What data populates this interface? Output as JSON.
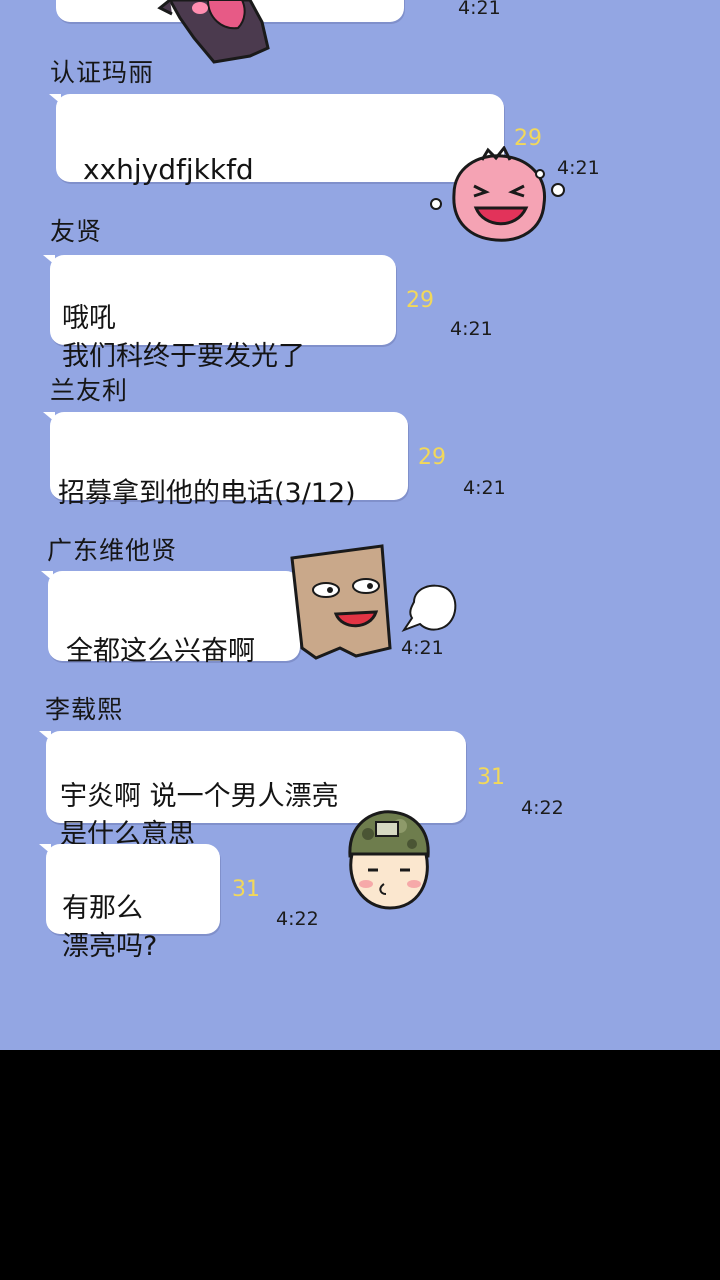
{
  "messages": [
    {
      "sender": "",
      "text": "",
      "count": "",
      "time": "4:21"
    },
    {
      "sender": "认证玛丽",
      "text": "xxhjydfjkkfd",
      "count": "29",
      "time": "4:21"
    },
    {
      "sender": "友贤",
      "text": "哦吼\n我们科终于要发光了",
      "count": "29",
      "time": "4:21"
    },
    {
      "sender": "兰友利",
      "text": "招募拿到他的电话(3/12)",
      "count": "29",
      "time": "4:21"
    },
    {
      "sender": "广东维他贤",
      "text": "全都这么兴奋啊",
      "count": "",
      "time": "4:21"
    },
    {
      "sender": "李载熙",
      "text": "宇炎啊 说一个男人漂亮\n是什么意思",
      "count": "31",
      "time": "4:22"
    },
    {
      "sender": "",
      "text": "有那么\n漂亮吗?",
      "count": "31",
      "time": "4:22"
    }
  ],
  "colors": {
    "background": "#93a6e3",
    "bubble": "#ffffff",
    "unread_count": "#f2d85a",
    "bottom_bar": "#000000"
  },
  "stickers": [
    "dark-creature-sticker",
    "crying-pink-blob-sticker",
    "paper-bag-face-sticker",
    "soldier-face-sticker"
  ]
}
